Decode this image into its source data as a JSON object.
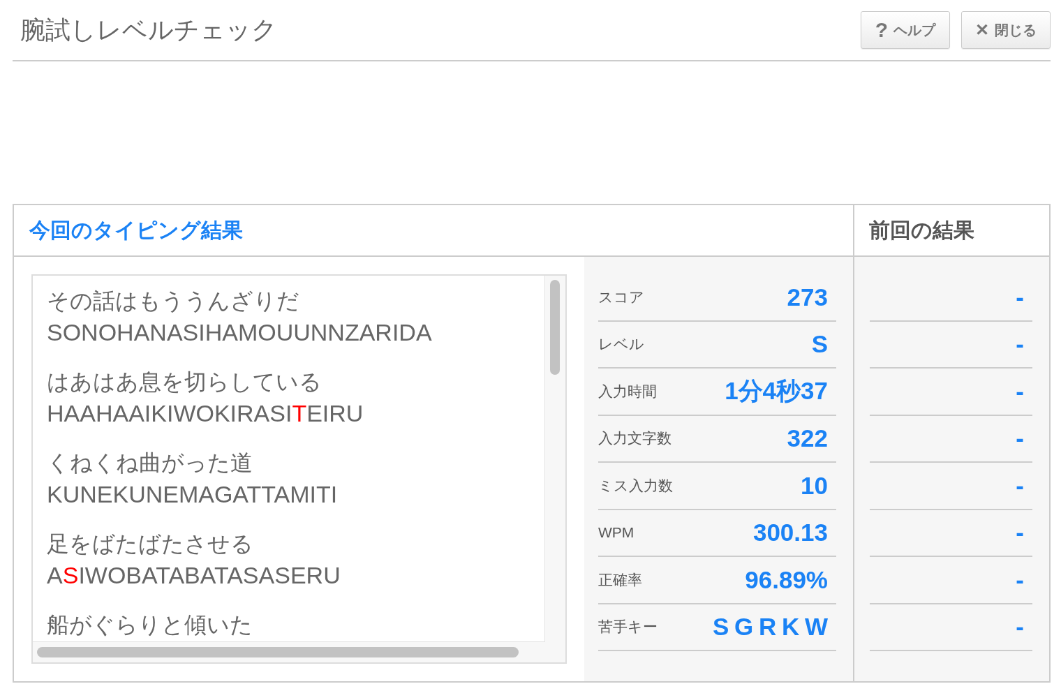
{
  "header": {
    "title": "腕試しレベルチェック",
    "buttons": [
      {
        "kind": "help",
        "icon": "?",
        "label": "ヘルプ"
      },
      {
        "kind": "close",
        "icon": "✕",
        "label": "閉じる"
      }
    ]
  },
  "results": {
    "title": "今回のタイピング結果",
    "phrases": [
      {
        "kana": "その話はもううんざりだ",
        "romaji": [
          {
            "text": "SONOHANASIHAMOUUNNZARIDA",
            "miss": false
          }
        ]
      },
      {
        "kana": "はあはあ息を切らしている",
        "romaji": [
          {
            "text": "HAAHAAIKIWOKIRASI",
            "miss": false
          },
          {
            "text": "T",
            "miss": true
          },
          {
            "text": "EIRU",
            "miss": false
          }
        ]
      },
      {
        "kana": "くねくね曲がった道",
        "romaji": [
          {
            "text": "KUNEKUNEMAGATTAMITI",
            "miss": false
          }
        ]
      },
      {
        "kana": "足をばたばたさせる",
        "romaji": [
          {
            "text": "A",
            "miss": false
          },
          {
            "text": "S",
            "miss": true
          },
          {
            "text": "IWOBATABATASASERU",
            "miss": false
          }
        ]
      },
      {
        "kana": "船がぐらりと傾いた"
      }
    ],
    "stats": [
      {
        "label": "スコア",
        "value": "273"
      },
      {
        "label": "レベル",
        "value": "S"
      },
      {
        "label": "入力時間",
        "value": "1分4秒37"
      },
      {
        "label": "入力文字数",
        "value": "322"
      },
      {
        "label": "ミス入力数",
        "value": "10"
      },
      {
        "label": "WPM",
        "value": "300.13"
      },
      {
        "label": "正確率",
        "value": "96.89%"
      },
      {
        "label": "苦手キー",
        "value": "S G R K W"
      }
    ]
  },
  "previous": {
    "title": "前回の結果",
    "values": [
      "-",
      "-",
      "-",
      "-",
      "-",
      "-",
      "-",
      "-"
    ]
  }
}
